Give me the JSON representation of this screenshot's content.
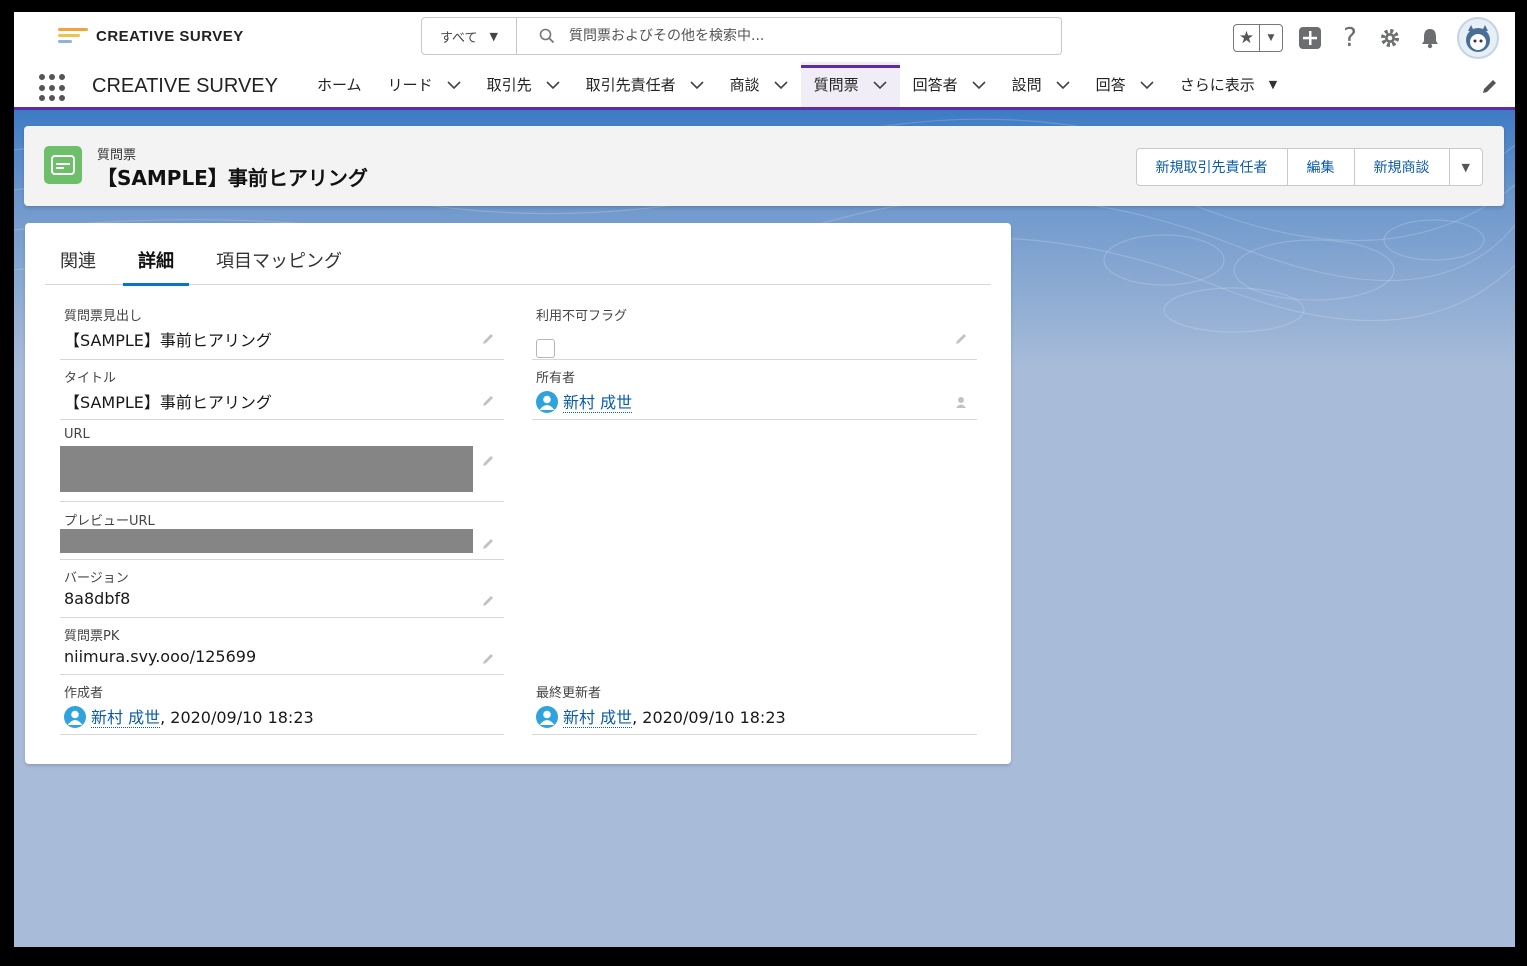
{
  "header": {
    "logo_text": "CREATIVE SURVEY",
    "search_scope": "すべて",
    "search_placeholder": "質問票およびその他を検索中..."
  },
  "nav": {
    "app_name": "CREATIVE SURVEY",
    "items": [
      {
        "label": "ホーム",
        "dropdown": false
      },
      {
        "label": "リード",
        "dropdown": true
      },
      {
        "label": "取引先",
        "dropdown": true
      },
      {
        "label": "取引先責任者",
        "dropdown": true
      },
      {
        "label": "商談",
        "dropdown": true
      },
      {
        "label": "質問票",
        "dropdown": true,
        "active": true
      },
      {
        "label": "回答者",
        "dropdown": true
      },
      {
        "label": "設問",
        "dropdown": true
      },
      {
        "label": "回答",
        "dropdown": true
      }
    ],
    "more_label": "さらに表示"
  },
  "record": {
    "type": "質問票",
    "title": "【SAMPLE】事前ヒアリング",
    "actions": [
      "新規取引先責任者",
      "編集",
      "新規商談"
    ]
  },
  "tabs": [
    "関連",
    "詳細",
    "項目マッピング"
  ],
  "active_tab": "詳細",
  "fields": {
    "survey_heading": {
      "label": "質問票見出し",
      "value": "【SAMPLE】事前ヒアリング"
    },
    "title": {
      "label": "タイトル",
      "value": "【SAMPLE】事前ヒアリング"
    },
    "url": {
      "label": "URL",
      "value": ""
    },
    "preview_url": {
      "label": "プレビューURL",
      "value": ""
    },
    "version": {
      "label": "バージョン",
      "value": "8a8dbf8"
    },
    "survey_pk": {
      "label": "質問票PK",
      "value": "niimura.svy.ooo/125699"
    },
    "created_by": {
      "label": "作成者",
      "user": "新村 成世",
      "date": ", 2020/09/10 18:23"
    },
    "unavailable_flag": {
      "label": "利用不可フラグ",
      "checked": false
    },
    "owner": {
      "label": "所有者",
      "user": "新村 成世"
    },
    "last_modified_by": {
      "label": "最終更新者",
      "user": "新村 成世",
      "date": ", 2020/09/10 18:23"
    }
  },
  "colors": {
    "nav_accent": "#5e2ca5",
    "link": "#0b5cab",
    "record_icon": "#6dbf6a",
    "background": "#a8bcd9"
  }
}
